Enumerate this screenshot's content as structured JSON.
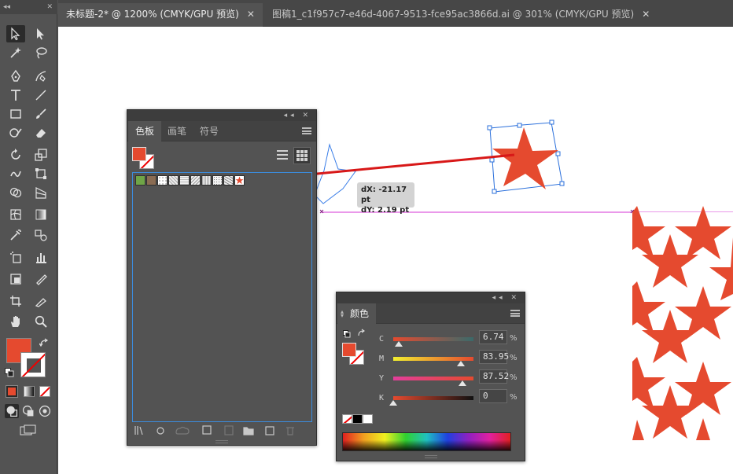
{
  "tabs": [
    {
      "label": "未标题-2* @ 1200% (CMYK/GPU 预览)",
      "active": true
    },
    {
      "label": "图稿1_c1f957c7-e46d-4067-9513-fce95ac3866d.ai @ 301% (CMYK/GPU 预览)",
      "active": false
    }
  ],
  "tab_close_glyph": "✕",
  "toolbar": {
    "grip_label": "◂◂",
    "close_glyph": "✕",
    "fill_color": "#e54a2f"
  },
  "swatches_panel": {
    "tabs": [
      "色板",
      "画笔",
      "符号"
    ],
    "active_tab": "色板",
    "swatch_colors": [
      "#6fa547",
      "#8a6c53",
      "#ffffff",
      "#cfcfcf",
      "#dcdcdc",
      "#e0e0e0",
      "#bfbfbf",
      "#d8d8d8",
      "#cacaca",
      "#ffffff"
    ],
    "title_glyphs": "◂◂ ✕"
  },
  "color_panel": {
    "tab": "颜色",
    "title_glyphs": "◂◂ ✕",
    "channels": [
      {
        "label": "C",
        "value": "6.74",
        "pct": "%"
      },
      {
        "label": "M",
        "value": "83.95",
        "pct": "%"
      },
      {
        "label": "Y",
        "value": "87.52",
        "pct": "%"
      },
      {
        "label": "K",
        "value": "0",
        "pct": "%"
      }
    ]
  },
  "tooltip": {
    "dx": "dX: -21.17 pt",
    "dy": "dY: 2.19 pt"
  },
  "colors": {
    "star": "#e54a2f",
    "selection": "#2a6fdb",
    "guide": "#d633d6",
    "arrow": "#d81818"
  }
}
